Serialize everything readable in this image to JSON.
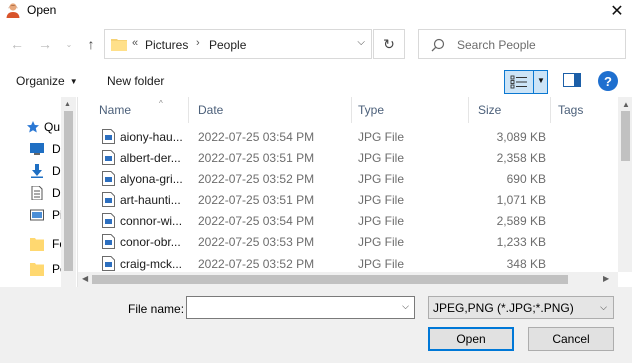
{
  "window": {
    "title": "Open"
  },
  "nav": {
    "breadcrumbs": [
      "Pictures",
      "People"
    ],
    "overflow_marker": "«",
    "search_placeholder": "Search People"
  },
  "toolbar": {
    "organize_label": "Organize",
    "new_folder_label": "New folder"
  },
  "sidebar": {
    "items": [
      {
        "label": "Qu",
        "icon": "star-icon"
      },
      {
        "label": "D",
        "icon": "desktop-icon"
      },
      {
        "label": "D",
        "icon": "download-icon"
      },
      {
        "label": "D",
        "icon": "document-icon"
      },
      {
        "label": "Pi",
        "icon": "pictures-icon"
      },
      {
        "label": "Fo",
        "icon": "folder-icon"
      },
      {
        "label": "Pe",
        "icon": "folder-icon"
      }
    ]
  },
  "files": {
    "columns": [
      "Name",
      "Date",
      "Type",
      "Size",
      "Tags"
    ],
    "rows": [
      {
        "name": "aiony-hau...",
        "date": "2022-07-25 03:54 PM",
        "type": "JPG File",
        "size": "3,089 KB"
      },
      {
        "name": "albert-der...",
        "date": "2022-07-25 03:51 PM",
        "type": "JPG File",
        "size": "2,358 KB"
      },
      {
        "name": "alyona-gri...",
        "date": "2022-07-25 03:52 PM",
        "type": "JPG File",
        "size": "690 KB"
      },
      {
        "name": "art-haunti...",
        "date": "2022-07-25 03:51 PM",
        "type": "JPG File",
        "size": "1,071 KB"
      },
      {
        "name": "connor-wi...",
        "date": "2022-07-25 03:54 PM",
        "type": "JPG File",
        "size": "2,589 KB"
      },
      {
        "name": "conor-obr...",
        "date": "2022-07-25 03:53 PM",
        "type": "JPG File",
        "size": "1,233 KB"
      },
      {
        "name": "craig-mck...",
        "date": "2022-07-25 03:52 PM",
        "type": "JPG File",
        "size": "348 KB"
      }
    ]
  },
  "footer": {
    "file_name_label": "File name:",
    "file_name_value": "",
    "filter_value": "JPEG,PNG (*.JPG;*.PNG)",
    "open_label": "Open",
    "cancel_label": "Cancel"
  },
  "colors": {
    "accent": "#0078d7",
    "selected_view_bg": "#cce4f7",
    "header_text": "#4c607a"
  }
}
